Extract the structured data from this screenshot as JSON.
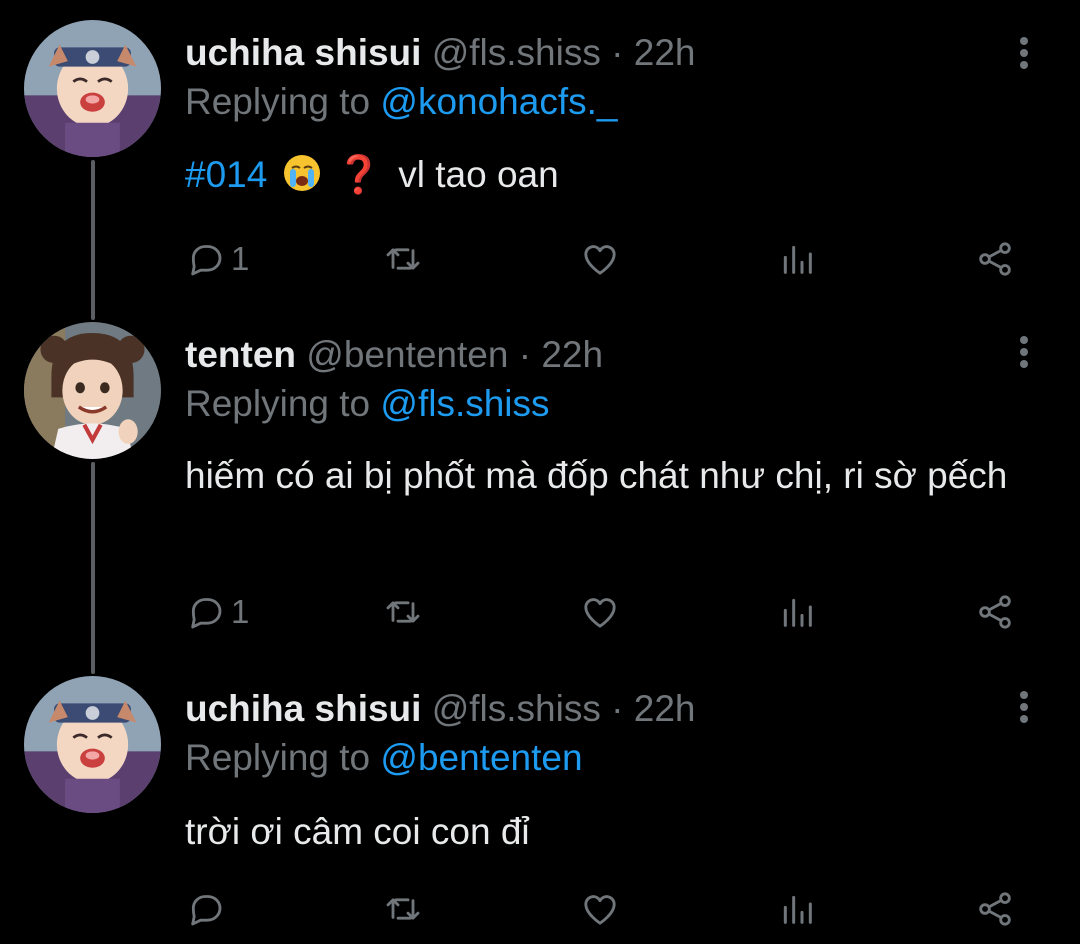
{
  "theme": {
    "background": "#000000",
    "text": "#e7e9ea",
    "muted": "#71767b",
    "accent": "#1d9bf0",
    "thread_line": "#5b5f63"
  },
  "tweets": [
    {
      "display_name": "uchiha shisui",
      "handle": "@fls.shiss",
      "separator": "·",
      "time": "22h",
      "replying_prefix": "Replying to",
      "replying_to": "@konohacfs._",
      "hashtag": "#014",
      "emoji_1": "crying-face-emoji",
      "emoji_2": "❓",
      "text": "vl tao oan",
      "reply_count": "1",
      "avatar": "anime-avatar-shisui"
    },
    {
      "display_name": "tenten",
      "handle": "@bententen",
      "separator": "·",
      "time": "22h",
      "replying_prefix": "Replying to",
      "replying_to": "@fls.shiss",
      "text": "hiếm có ai bị phốt mà đốp chát như chị, ri sờ pếch",
      "reply_count": "1",
      "avatar": "anime-avatar-tenten"
    },
    {
      "display_name": "uchiha shisui",
      "handle": "@fls.shiss",
      "separator": "·",
      "time": "22h",
      "replying_prefix": "Replying to",
      "replying_to": "@bententen",
      "text": "trời ơi câm coi con đỉ",
      "reply_count": "",
      "avatar": "anime-avatar-shisui"
    }
  ]
}
